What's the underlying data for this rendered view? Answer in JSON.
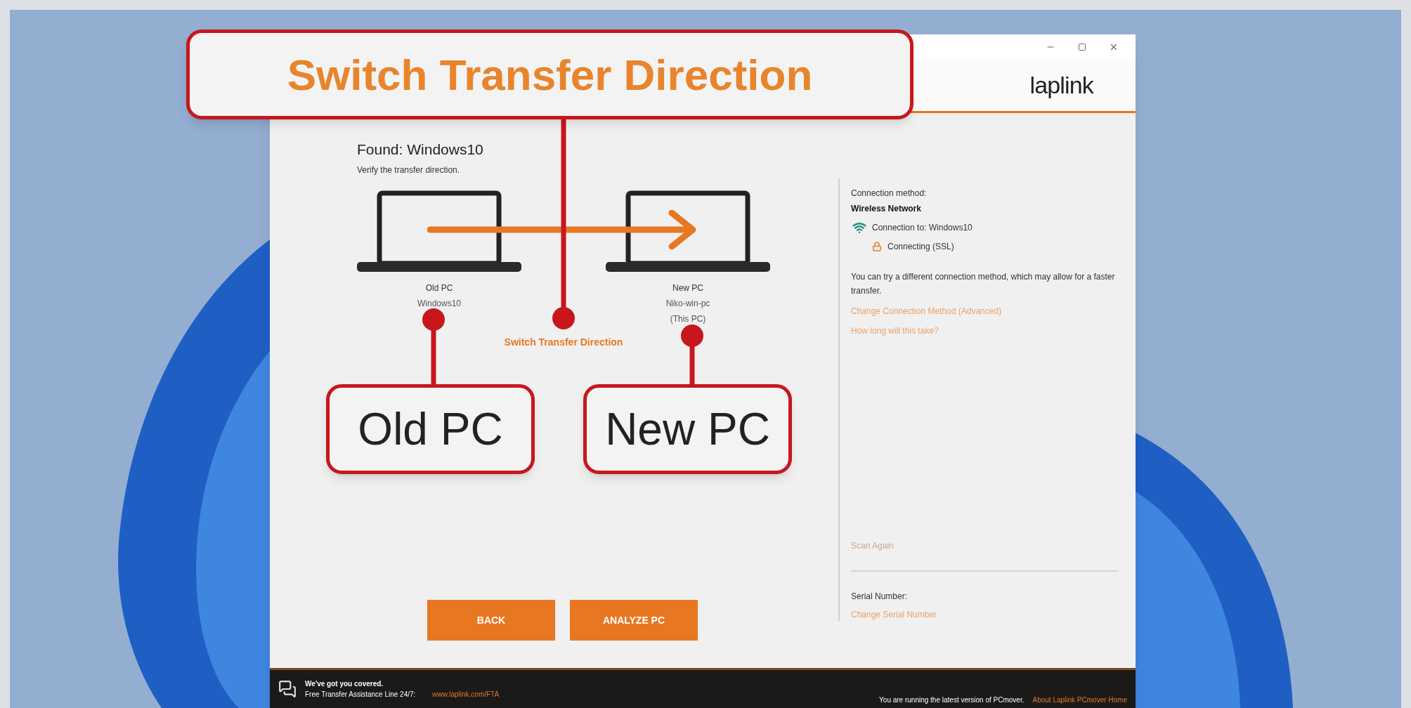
{
  "callouts": [
    {
      "text": "Switch Transfer Direction"
    },
    {
      "text": "Old PC"
    },
    {
      "text": "New PC"
    }
  ],
  "header": {
    "logo": "laplink"
  },
  "found": {
    "title": "Found: Windows10",
    "subtitle": "Verify the transfer direction."
  },
  "computers": [
    {
      "role": "Old PC",
      "lines": [
        "Windows10"
      ]
    },
    {
      "role": "New PC",
      "lines": [
        "Niko-win-pc",
        "(This PC)"
      ]
    }
  ],
  "switch_link": "Switch Transfer Direction",
  "connection": {
    "label": "Connection method:",
    "method": "Wireless Network",
    "status": [
      {
        "kind": "wifi",
        "text": "Connection to: Windows10"
      },
      {
        "kind": "lock",
        "text": "Connecting (SSL)"
      }
    ],
    "hint": "You can try a different connection method, which may allow for a faster transfer.",
    "links": [
      "Change Connection Method (Advanced)",
      "How long will this take?"
    ]
  },
  "scan_link": "Scan Again",
  "serial": {
    "label": "Serial Number:",
    "link": "Change Serial Number"
  },
  "buttons": [
    "BACK",
    "ANALYZE PC"
  ],
  "footer": {
    "lines": [
      "We've got you covered.",
      "Free Transfer Assistance Line 24/7:"
    ],
    "link": "www.laplink.com/FTA",
    "status": "You are running the latest version of PCmover.",
    "about_link": "About Laplink PCmover Home"
  }
}
